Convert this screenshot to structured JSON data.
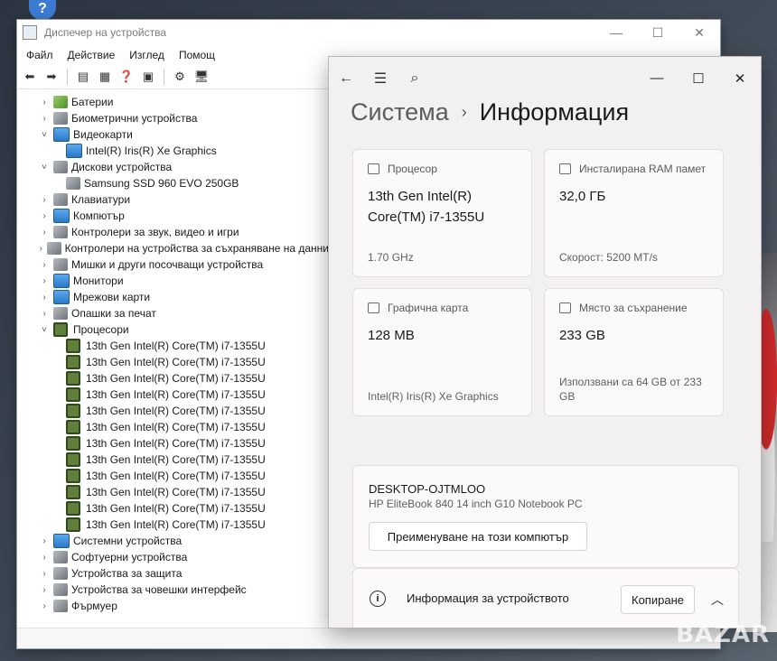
{
  "device_manager": {
    "title": "Диспечер на устройства",
    "menu": [
      "Файл",
      "Действие",
      "Изглед",
      "Помощ"
    ],
    "tree": [
      {
        "chev": "›",
        "icon": "battery-icon",
        "cls": "green",
        "indent": 1,
        "label": "Батерии"
      },
      {
        "chev": "›",
        "icon": "fingerprint-icon",
        "cls": "gray",
        "indent": 1,
        "label": "Биометрични устройства"
      },
      {
        "chev": "˅",
        "icon": "display-adapter-icon",
        "cls": "mon",
        "indent": 1,
        "label": "Видеокарти"
      },
      {
        "chev": "",
        "icon": "display-adapter-icon",
        "cls": "mon",
        "indent": 2,
        "label": "Intel(R) Iris(R) Xe Graphics"
      },
      {
        "chev": "˅",
        "icon": "disk-drive-icon",
        "cls": "gray",
        "indent": 1,
        "label": "Дискови устройства"
      },
      {
        "chev": "",
        "icon": "disk-drive-icon",
        "cls": "gray",
        "indent": 2,
        "label": "Samsung SSD 960 EVO 250GB"
      },
      {
        "chev": "›",
        "icon": "keyboard-icon",
        "cls": "gray",
        "indent": 1,
        "label": "Клавиатури"
      },
      {
        "chev": "›",
        "icon": "computer-icon",
        "cls": "mon",
        "indent": 1,
        "label": "Компютър"
      },
      {
        "chev": "›",
        "icon": "sound-icon",
        "cls": "gray",
        "indent": 1,
        "label": "Контролери за звук, видео и игри"
      },
      {
        "chev": "›",
        "icon": "storage-controller-icon",
        "cls": "gray",
        "indent": 1,
        "label": "Контролери на устройства за съхраняване на данни"
      },
      {
        "chev": "›",
        "icon": "mouse-icon",
        "cls": "gray",
        "indent": 1,
        "label": "Мишки и други посочващи устройства"
      },
      {
        "chev": "›",
        "icon": "monitor-icon",
        "cls": "mon",
        "indent": 1,
        "label": "Монитори"
      },
      {
        "chev": "›",
        "icon": "network-adapter-icon",
        "cls": "mon",
        "indent": 1,
        "label": "Мрежови карти"
      },
      {
        "chev": "›",
        "icon": "print-queue-icon",
        "cls": "gray",
        "indent": 1,
        "label": "Опашки за печат"
      },
      {
        "chev": "˅",
        "icon": "processor-icon",
        "cls": "cpu",
        "indent": 1,
        "label": "Процесори"
      },
      {
        "chev": "",
        "icon": "processor-icon",
        "cls": "cpu",
        "indent": 2,
        "label": "13th Gen Intel(R) Core(TM) i7-1355U"
      },
      {
        "chev": "",
        "icon": "processor-icon",
        "cls": "cpu",
        "indent": 2,
        "label": "13th Gen Intel(R) Core(TM) i7-1355U"
      },
      {
        "chev": "",
        "icon": "processor-icon",
        "cls": "cpu",
        "indent": 2,
        "label": "13th Gen Intel(R) Core(TM) i7-1355U"
      },
      {
        "chev": "",
        "icon": "processor-icon",
        "cls": "cpu",
        "indent": 2,
        "label": "13th Gen Intel(R) Core(TM) i7-1355U"
      },
      {
        "chev": "",
        "icon": "processor-icon",
        "cls": "cpu",
        "indent": 2,
        "label": "13th Gen Intel(R) Core(TM) i7-1355U"
      },
      {
        "chev": "",
        "icon": "processor-icon",
        "cls": "cpu",
        "indent": 2,
        "label": "13th Gen Intel(R) Core(TM) i7-1355U"
      },
      {
        "chev": "",
        "icon": "processor-icon",
        "cls": "cpu",
        "indent": 2,
        "label": "13th Gen Intel(R) Core(TM) i7-1355U"
      },
      {
        "chev": "",
        "icon": "processor-icon",
        "cls": "cpu",
        "indent": 2,
        "label": "13th Gen Intel(R) Core(TM) i7-1355U"
      },
      {
        "chev": "",
        "icon": "processor-icon",
        "cls": "cpu",
        "indent": 2,
        "label": "13th Gen Intel(R) Core(TM) i7-1355U"
      },
      {
        "chev": "",
        "icon": "processor-icon",
        "cls": "cpu",
        "indent": 2,
        "label": "13th Gen Intel(R) Core(TM) i7-1355U"
      },
      {
        "chev": "",
        "icon": "processor-icon",
        "cls": "cpu",
        "indent": 2,
        "label": "13th Gen Intel(R) Core(TM) i7-1355U"
      },
      {
        "chev": "",
        "icon": "processor-icon",
        "cls": "cpu",
        "indent": 2,
        "label": "13th Gen Intel(R) Core(TM) i7-1355U"
      },
      {
        "chev": "›",
        "icon": "system-devices-icon",
        "cls": "mon",
        "indent": 1,
        "label": "Системни устройства"
      },
      {
        "chev": "›",
        "icon": "software-device-icon",
        "cls": "gray",
        "indent": 1,
        "label": "Софтуерни устройства"
      },
      {
        "chev": "›",
        "icon": "security-device-icon",
        "cls": "gray",
        "indent": 1,
        "label": "Устройства за защита"
      },
      {
        "chev": "›",
        "icon": "hid-icon",
        "cls": "gray",
        "indent": 1,
        "label": "Устройства за човешки интерфейс"
      },
      {
        "chev": "›",
        "icon": "firmware-icon",
        "cls": "gray",
        "indent": 1,
        "label": "Фърмуер"
      }
    ]
  },
  "settings": {
    "breadcrumb_parent": "Система",
    "breadcrumb_current": "Информация",
    "processor": {
      "label": "Процесор",
      "value_line1": "13th Gen Intel(R)",
      "value_line2": "Core(TM) i7-1355U",
      "sub": "1.70 GHz"
    },
    "ram": {
      "label": "Инсталирана RAM памет",
      "value": "32,0 ГБ",
      "sub": "Скорост: 5200 MT/s"
    },
    "gpu": {
      "label": "Графична карта",
      "value": "128 MB",
      "sub": "Intel(R) Iris(R) Xe Graphics"
    },
    "storage": {
      "label": "Място за съхранение",
      "value": "233 GB",
      "sub_line1": "Използвани са 64 GB от 233",
      "sub_line2": "GB"
    },
    "pc_name": "DESKTOP-OJTMLOO",
    "pc_model": "HP EliteBook 840 14 inch G10 Notebook PC",
    "rename_button": "Преименуване на този компютър",
    "device_info_label": "Информация за устройството",
    "copy_button": "Копиране"
  },
  "watermark": "BAZAR"
}
